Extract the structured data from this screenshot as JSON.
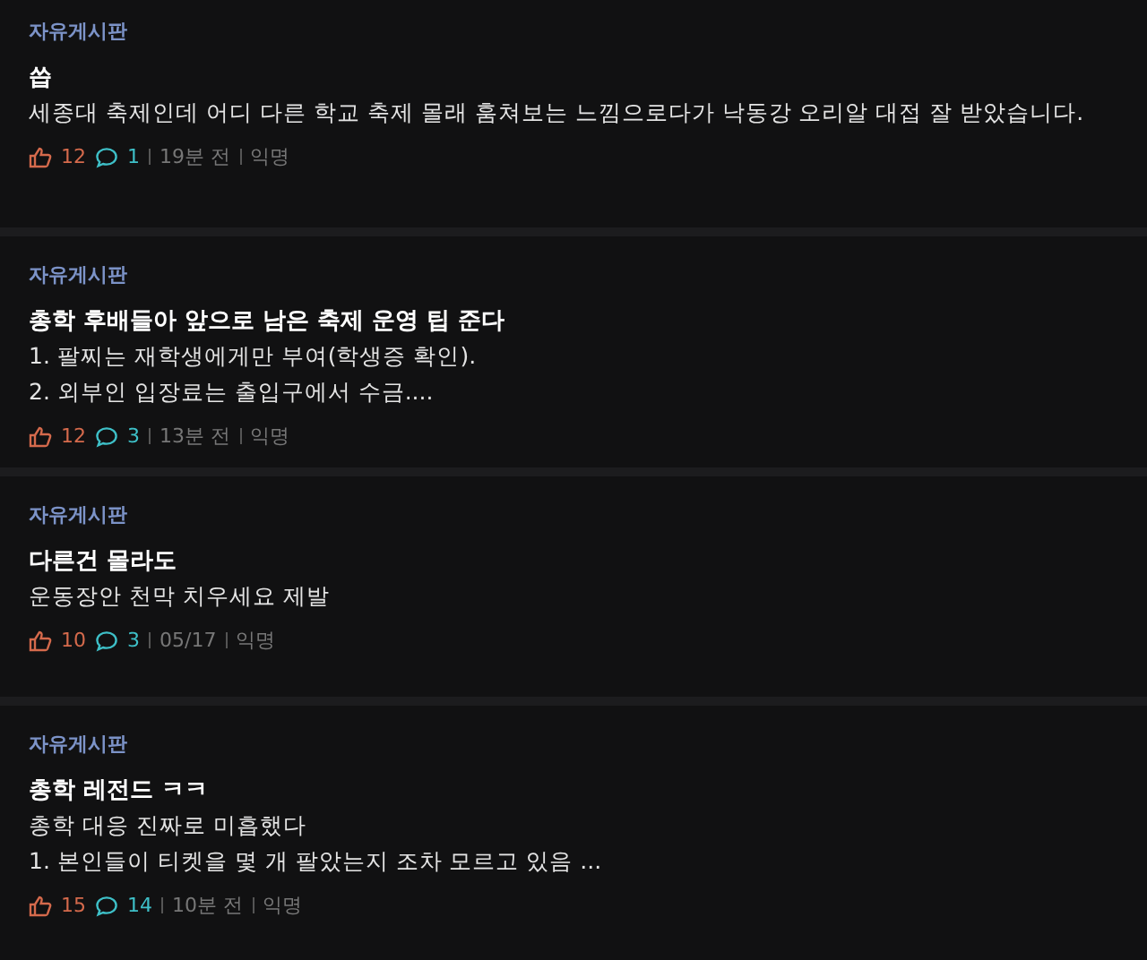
{
  "posts": [
    {
      "board": "자유게시판",
      "title": "씁",
      "body_lines": [
        "세종대 축제인데 어디 다른 학교 축제 몰래 훔쳐보는 느낌으로다가 낙동강 오리알 대접 잘 받았습니다."
      ],
      "likes": "12",
      "comments": "1",
      "time": "19분 전",
      "author": "익명"
    },
    {
      "board": "자유게시판",
      "title": "총학 후배들아 앞으로 남은 축제 운영 팁 준다",
      "body_lines": [
        "1. 팔찌는 재학생에게만 부여(학생증 확인).",
        "2. 외부인 입장료는 출입구에서 수금...."
      ],
      "likes": "12",
      "comments": "3",
      "time": "13분 전",
      "author": "익명"
    },
    {
      "board": "자유게시판",
      "title": "다른건 몰라도",
      "body_lines": [
        "운동장안 천막 치우세요 제발"
      ],
      "likes": "10",
      "comments": "3",
      "time": "05/17",
      "author": "익명"
    },
    {
      "board": "자유게시판",
      "title": "총학 레전드 ㅋㅋ",
      "body_lines": [
        "총학 대응 진짜로 미흡했다",
        "1. 본인들이 티켓을 몇 개 팔았는지 조차 모르고 있음 ..."
      ],
      "likes": "15",
      "comments": "14",
      "time": "10분 전",
      "author": "익명"
    }
  ]
}
